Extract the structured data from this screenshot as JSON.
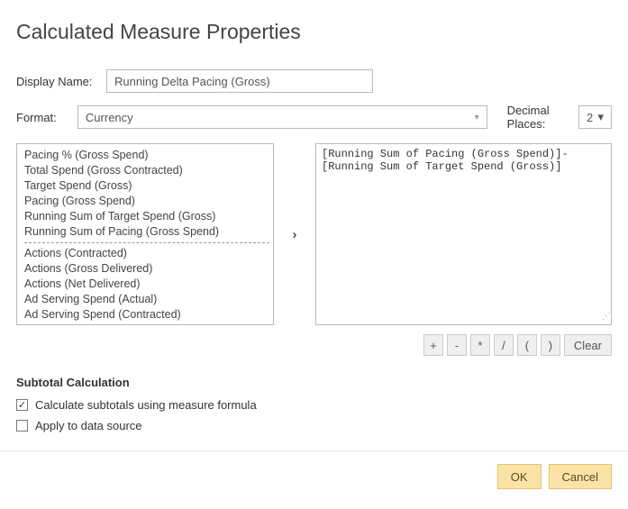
{
  "title": "Calculated Measure Properties",
  "fields": {
    "display_name_label": "Display Name:",
    "display_name_value": "Running Delta Pacing (Gross)",
    "format_label": "Format:",
    "format_value": "Currency",
    "decimal_label": "Decimal Places:",
    "decimal_value": "2"
  },
  "list_items_top": [
    "Pacing % (Gross Spend)",
    "Total Spend (Gross Contracted)",
    "Target Spend (Gross)",
    "Pacing (Gross Spend)",
    "Running Sum of Target Spend (Gross)",
    "Running Sum of Pacing (Gross Spend)"
  ],
  "list_items_bottom": [
    "Actions (Contracted)",
    "Actions (Gross Delivered)",
    "Actions (Net Delivered)",
    "Ad Serving Spend (Actual)",
    "Ad Serving Spend (Contracted)"
  ],
  "formula_text": "[Running Sum of Pacing (Gross Spend)]-[Running Sum of Target Spend (Gross)]",
  "operators": {
    "plus": "+",
    "minus": "-",
    "times": "*",
    "div": "/",
    "lparen": "(",
    "rparen": ")",
    "clear": "Clear"
  },
  "subtotal": {
    "heading": "Subtotal Calculation",
    "opt1": "Calculate subtotals using measure formula",
    "opt1_checked": "✓",
    "opt2": "Apply to data source",
    "opt2_checked": ""
  },
  "footer": {
    "ok": "OK",
    "cancel": "Cancel"
  }
}
